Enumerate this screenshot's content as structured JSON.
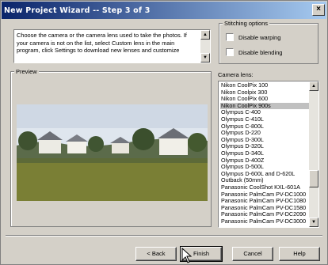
{
  "window": {
    "title": "New Project Wizard -- Step 3 of 3",
    "close_glyph": "×"
  },
  "description": {
    "text": "Choose the camera or the camera lens used to take the photos. If your camera is not on the list, select Custom lens in the main program, click Settings to download new lenses and customize"
  },
  "stitching": {
    "group_label": "Stitching options",
    "options": [
      {
        "label": "Disable warping",
        "checked": false
      },
      {
        "label": "Disable blending",
        "checked": false
      }
    ]
  },
  "preview": {
    "group_label": "Preview"
  },
  "lens": {
    "label": "Camera lens:",
    "selected_index": 3,
    "items": [
      "Nikon CoolPix 100",
      "Nikon Coolpix 300",
      "Nikon CoolPix 600",
      "Nikon CoolPix 900s",
      "Olympus C-400",
      "Olympus C-410L",
      "Olympus C-800L",
      "Olympus D-220",
      "Olympus D-300L",
      "Olympus D-320L",
      "Olympus D-340L",
      "Olympus D-400Z",
      "Olympus D-500L",
      "Olympus D-600L and D-620L",
      "Outback (50mm)",
      "Panasonic CoolShot KXL-601A",
      "Panasonic PalmCam PV-DC1000",
      "Panasonic PalmCam PV-DC1080",
      "Panasonic PalmCam PV-DC1580",
      "Panasonic PalmCam PV-DC2090",
      "Panasonic PalmCam PV-DC3000"
    ]
  },
  "buttons": {
    "back": "< Back",
    "finish": "Finish",
    "cancel": "Cancel",
    "help": "Help"
  }
}
